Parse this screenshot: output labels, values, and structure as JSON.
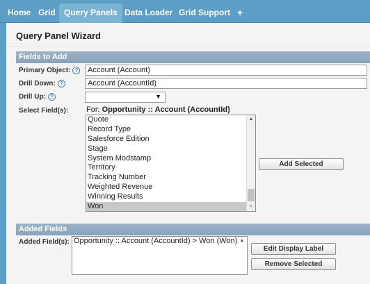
{
  "nav": {
    "tabs": [
      {
        "label": "Home"
      },
      {
        "label": "Grid"
      },
      {
        "label": "Query Panels",
        "active": true
      },
      {
        "label": "Data Loader"
      },
      {
        "label": "Grid Support"
      }
    ],
    "add_tab": "+"
  },
  "panel": {
    "title": "Query Panel Wizard"
  },
  "fields_to_add": {
    "header": "Fields to Add",
    "primary_object": {
      "label": "Primary Object:",
      "value": "Account (Account)"
    },
    "drill_down": {
      "label": "Drill Down:",
      "value": "Account (AccountId)"
    },
    "drill_up": {
      "label": "Drill Up:",
      "value": ""
    },
    "select_fields": {
      "label": "Select Field(s):",
      "for_prefix": "For:",
      "for_value": "Opportunity :: Account (AccountId)",
      "options": [
        "Quote",
        "Record Type",
        "Salesforce Edition",
        "Stage",
        "System Modstamp",
        "Territory",
        "Tracking Number",
        "Weighted Revenue",
        "Winning Results",
        "Won"
      ],
      "selected": "Won"
    },
    "add_selected_label": "Add Selected"
  },
  "added_fields": {
    "header": "Added Fields",
    "label": "Added Field(s):",
    "items": [
      "Opportunity :: Account (AccountId) > Won (Won)"
    ],
    "edit_display_label": "Edit Display Label",
    "remove_selected": "Remove Selected"
  },
  "icons": {
    "help": "help-icon",
    "dropdown": "chevron-down-icon"
  },
  "colors": {
    "nav": "#5c9ec6",
    "nav_active": "#7bb3d3",
    "section_header": "#8aa3b8"
  }
}
